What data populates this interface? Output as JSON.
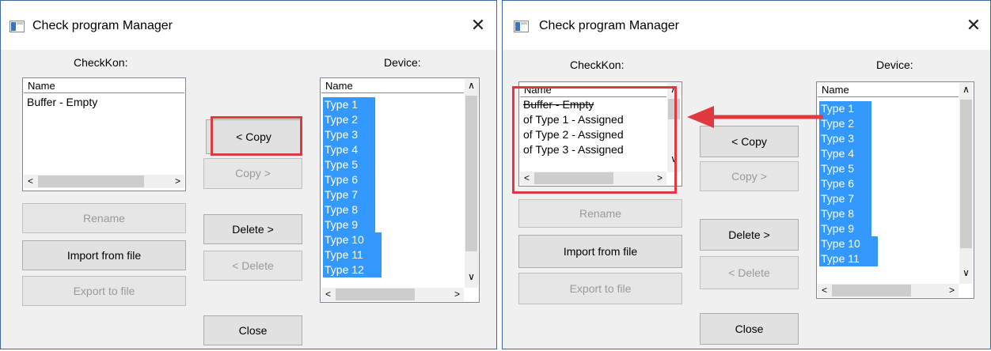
{
  "left_window": {
    "title": "Check program Manager",
    "close_glyph": "✕",
    "checkkon_label": "CheckKon:",
    "device_label": "Device:",
    "checkkon_list": {
      "header": "Name",
      "items": [
        "Buffer - Empty"
      ]
    },
    "device_list": {
      "header": "Name",
      "items": [
        "Type 1",
        "Type 2",
        "Type 3",
        "Type 4",
        "Type 5",
        "Type 6",
        "Type 7",
        "Type 8",
        "Type 9",
        "Type 10",
        "Type 11",
        "Type 12"
      ]
    },
    "buttons": {
      "copy_left": "< Copy",
      "copy_right": "Copy >",
      "delete_right": "Delete >",
      "delete_left": "< Delete",
      "rename": "Rename",
      "import": "Import from file",
      "export": "Export to file",
      "close": "Close"
    }
  },
  "right_window": {
    "title": "Check program Manager",
    "close_glyph": "✕",
    "checkkon_label": "CheckKon:",
    "device_label": "Device:",
    "checkkon_list": {
      "header": "Name",
      "items": [
        "Buffer - Empty",
        "of Type 1  - Assigned",
        "of Type 2  - Assigned",
        "of Type 3  - Assigned"
      ]
    },
    "device_list": {
      "header": "Name",
      "items": [
        "Type 1",
        "Type 2",
        "Type 3",
        "Type 4",
        "Type 5",
        "Type 6",
        "Type 7",
        "Type 8",
        "Type 9",
        "Type 10",
        "Type 11"
      ]
    },
    "buttons": {
      "copy_left": "< Copy",
      "copy_right": "Copy >",
      "delete_right": "Delete >",
      "delete_left": "< Delete",
      "rename": "Rename",
      "import": "Import from file",
      "export": "Export to file",
      "close": "Close"
    }
  },
  "glyphs": {
    "up": "∧",
    "down": "∨",
    "left": "<",
    "right": ">"
  },
  "colors": {
    "selection": "#3399ff",
    "annotation": "#e0393e",
    "window_border": "#3c6aa5"
  }
}
